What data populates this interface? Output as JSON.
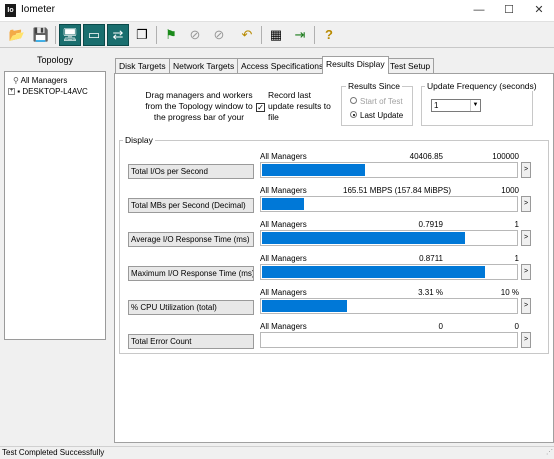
{
  "window": {
    "app_icon_text": "Io",
    "title": "Iometer",
    "minimize": "—",
    "maximize": "☐",
    "close": "✕"
  },
  "toolbar": {
    "buttons": [
      {
        "icon": "open-icon",
        "glyph": "📂"
      },
      {
        "icon": "save-icon",
        "glyph": "💾"
      },
      {
        "icon": "new-manager-icon",
        "glyph": "🖥"
      },
      {
        "icon": "new-disk-worker-icon",
        "glyph": "▭"
      },
      {
        "icon": "new-network-worker-icon",
        "glyph": "⇄"
      },
      {
        "icon": "copy-worker-icon",
        "glyph": "❐"
      },
      {
        "icon": "start-tests-icon",
        "glyph": "⚑"
      },
      {
        "icon": "stop-icon",
        "glyph": "⊘"
      },
      {
        "icon": "stop-all-icon",
        "glyph": "⊘"
      },
      {
        "icon": "reset-workers-icon",
        "glyph": "↶"
      },
      {
        "icon": "refresh-targets-icon",
        "glyph": "▦"
      },
      {
        "icon": "exit-icon",
        "glyph": "⇥"
      },
      {
        "icon": "help-icon",
        "glyph": "?"
      }
    ]
  },
  "topology": {
    "header": "Topology",
    "root": "All Managers",
    "manager": "DESKTOP-L4AVC"
  },
  "tabs": [
    "Disk Targets",
    "Network Targets",
    "Access Specifications",
    "Results Display",
    "Test Setup"
  ],
  "active_tab": "Results Display",
  "results": {
    "drag_text": "Drag managers and workers from the Topology window to the progress bar of your",
    "record_checked": "✓",
    "record_text": "Record last update results to file",
    "results_since": {
      "title": "Results Since",
      "start_of_test": "Start of Test",
      "last_update": "Last Update",
      "selected": "Last Update"
    },
    "update_frequency": {
      "title": "Update Frequency (seconds)",
      "value": "1"
    },
    "display_title": "Display",
    "metrics": [
      {
        "label": "Total I/Os per Second",
        "source": "All Managers",
        "value": "40406.85",
        "max": "100000",
        "fill": 0.404
      },
      {
        "label": "Total MBs per Second (Decimal)",
        "source": "All Managers",
        "value": "165.51 MBPS (157.84 MiBPS)",
        "max": "1000",
        "fill": 0.166
      },
      {
        "label": "Average I/O Response Time (ms)",
        "source": "All Managers",
        "value": "0.7919",
        "max": "1",
        "fill": 0.792
      },
      {
        "label": "Maximum I/O Response Time (ms)",
        "source": "All Managers",
        "value": "0.8711",
        "max": "1",
        "fill": 0.871
      },
      {
        "label": "% CPU Utilization (total)",
        "source": "All Managers",
        "value": "3.31 %",
        "max": "10 %",
        "fill": 0.331
      },
      {
        "label": "Total Error Count",
        "source": "All Managers",
        "value": "0",
        "max": "0",
        "fill": 0
      }
    ],
    "arrow_glyph": ">"
  },
  "status": {
    "text": "Test Completed Successfully"
  }
}
